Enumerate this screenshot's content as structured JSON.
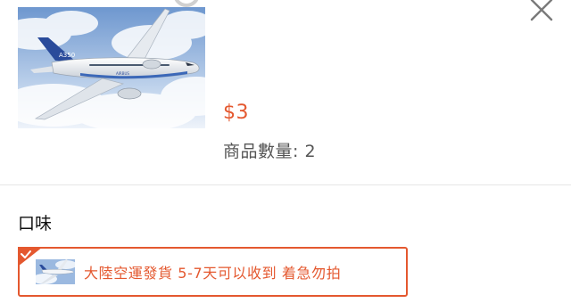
{
  "product": {
    "image_icon": "airplane-photo",
    "price": "$3",
    "quantity_label": "商品數量: 2"
  },
  "controls": {
    "close_icon": "close-icon"
  },
  "options": {
    "section_title": "口味",
    "selected_option_label": "大陸空運發貨 5-7天可以收到 着急勿拍"
  },
  "colors": {
    "accent": "#e4582f",
    "divider": "#e6e6e6",
    "sky_top": "#7fa6d6",
    "sky_bottom": "#e8f0fa"
  }
}
